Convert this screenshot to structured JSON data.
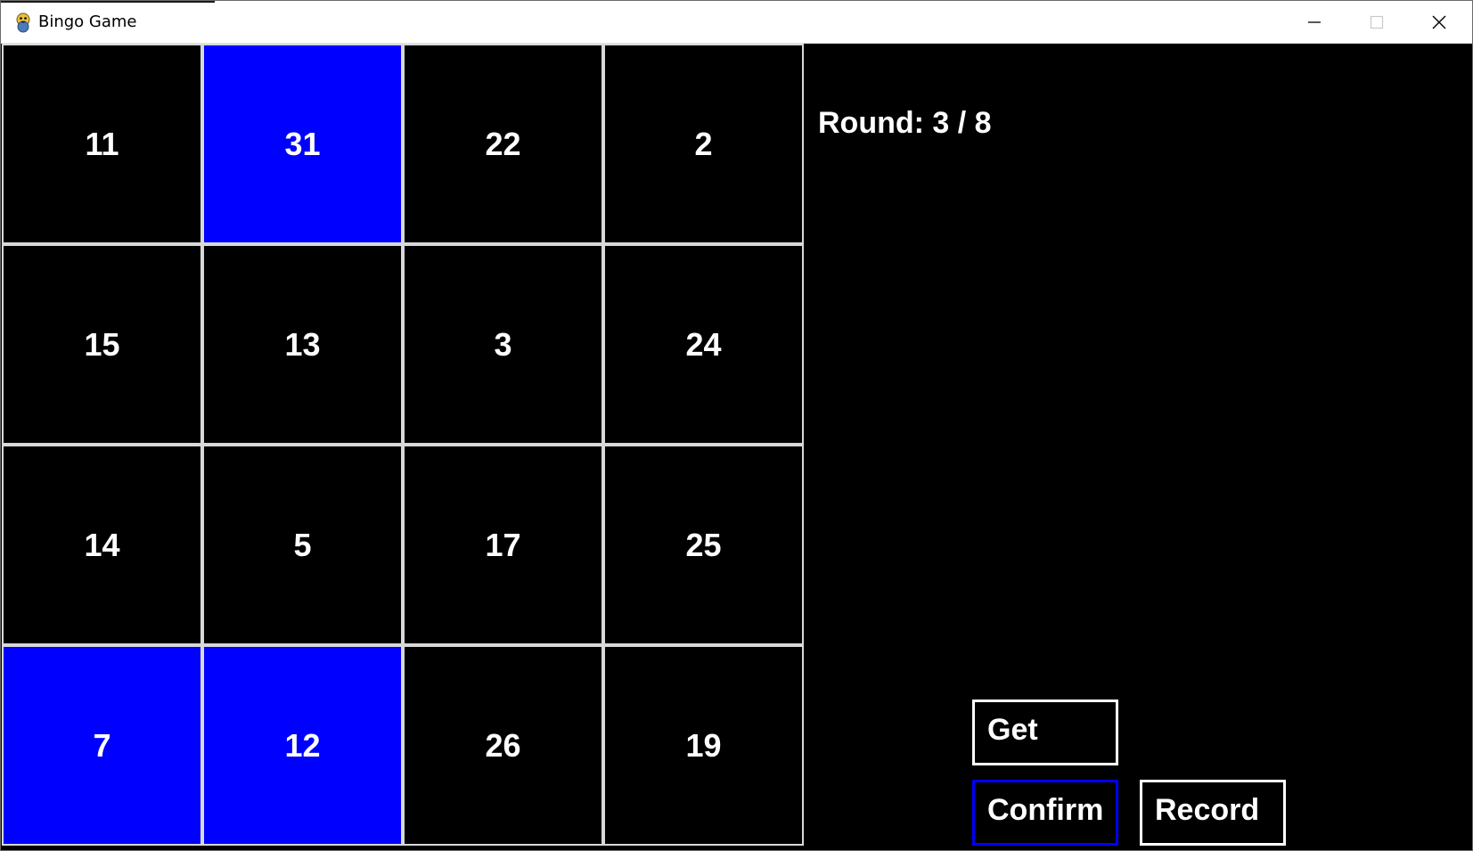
{
  "window": {
    "title": "Bingo Game",
    "icon": "python-snake-icon"
  },
  "board": {
    "rows": 4,
    "cols": 4,
    "marked_color": "#0000ff",
    "unmarked_color": "#000000",
    "cells": [
      {
        "value": "11",
        "marked": false
      },
      {
        "value": "31",
        "marked": true
      },
      {
        "value": "22",
        "marked": false
      },
      {
        "value": "2",
        "marked": false
      },
      {
        "value": "15",
        "marked": false
      },
      {
        "value": "13",
        "marked": false
      },
      {
        "value": "3",
        "marked": false
      },
      {
        "value": "24",
        "marked": false
      },
      {
        "value": "14",
        "marked": false
      },
      {
        "value": "5",
        "marked": false
      },
      {
        "value": "17",
        "marked": false
      },
      {
        "value": "25",
        "marked": false
      },
      {
        "value": "7",
        "marked": true
      },
      {
        "value": "12",
        "marked": true
      },
      {
        "value": "26",
        "marked": false
      },
      {
        "value": "19",
        "marked": false
      }
    ]
  },
  "panel": {
    "round_text": "Round: 3 / 8",
    "buttons": {
      "get_label": "Get",
      "confirm_label": "Confirm",
      "record_label": "Record"
    },
    "focused_button": "confirm",
    "focus_color": "#0000ff"
  }
}
